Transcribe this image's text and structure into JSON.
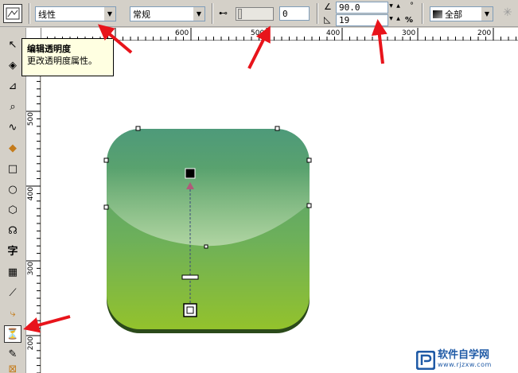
{
  "propbar": {
    "type_select": "线性",
    "mode_select": "常规",
    "midpoint_value": "0",
    "angle_value": "90.0",
    "edge_pad_value": "19",
    "angle_unit": "°",
    "percent_unit": "%",
    "apply_select": "全部"
  },
  "rulers": {
    "h_ticks": [
      "600",
      "500",
      "400",
      "300",
      "200"
    ],
    "v_ticks": [
      "500",
      "400",
      "300",
      "200"
    ]
  },
  "tooltip": {
    "title": "编辑透明度",
    "description": "更改透明度属性。"
  },
  "toolbox": {
    "text_tool_glyph": "字"
  },
  "watermark": {
    "brand_text": "软件自学网",
    "url": "www.rjzxw.com"
  },
  "colors": {
    "accent_red": "#e8141b",
    "icon_green_top": "#4e9a7a",
    "icon_green_bottom": "#93c22c",
    "logo_blue": "#1f5aa6"
  }
}
